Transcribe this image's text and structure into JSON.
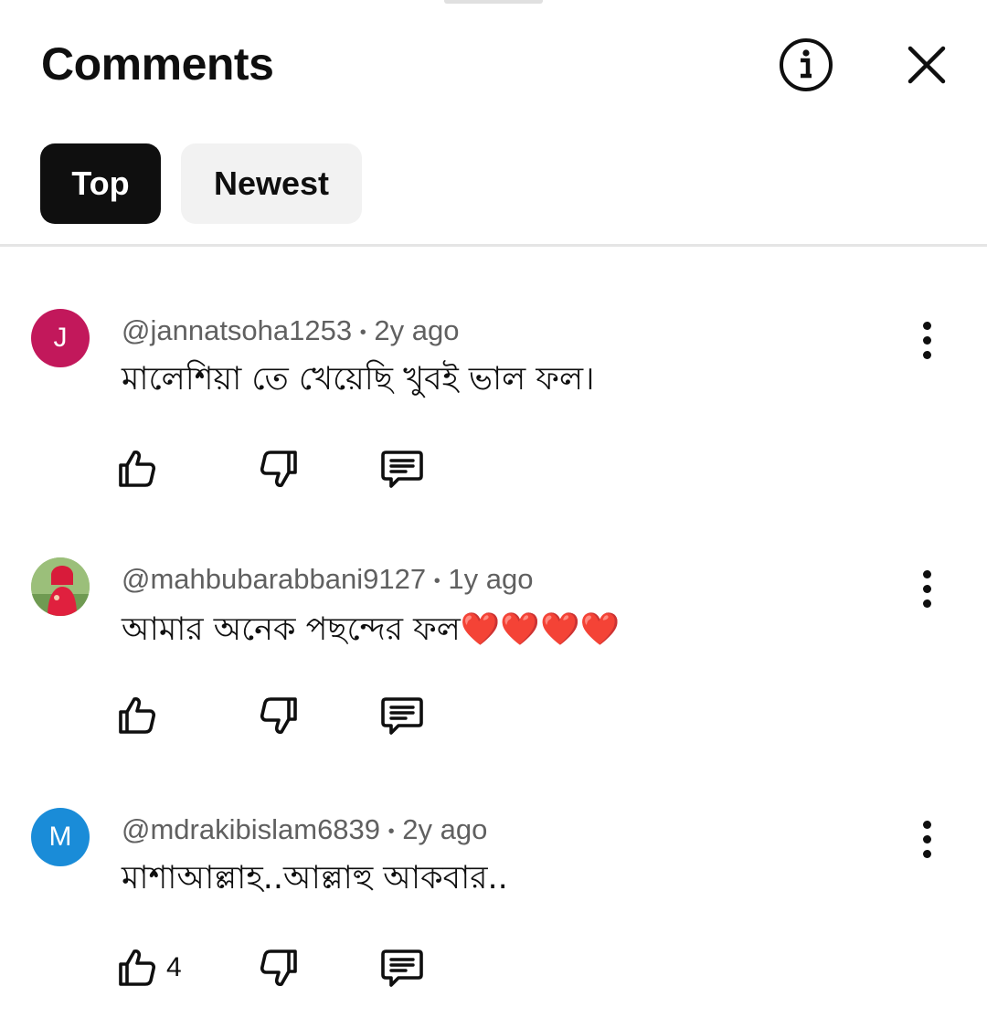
{
  "header": {
    "title": "Comments",
    "info_icon": "info-icon",
    "close_icon": "close-icon"
  },
  "tabs": [
    {
      "label": "Top",
      "selected": true
    },
    {
      "label": "Newest",
      "selected": false
    }
  ],
  "comments": [
    {
      "avatar_letter": "J",
      "avatar_color": "#c2185b",
      "author": "@jannatsoha1253",
      "separator": "•",
      "time": "2y ago",
      "text": "মালেশিয়া তে খেয়েছি খুবই ভাল ফল।",
      "likes": ""
    },
    {
      "avatar_letter": "",
      "avatar_color": "#a8c48a",
      "avatar_photo": true,
      "author": "@mahbubarabbani9127",
      "separator": "•",
      "time": "1y ago",
      "text": "আমার অনেক পছন্দের ফল",
      "emoji": "❤️❤️❤️❤️",
      "likes": ""
    },
    {
      "avatar_letter": "M",
      "avatar_color": "#1a8cd8",
      "author": "@mdrakibislam6839",
      "separator": "•",
      "time": "2y ago",
      "text": "মাশাআল্লাহ..আল্লাহু আকবার..",
      "likes": "4"
    }
  ],
  "colors": {
    "chip_selected_bg": "#0f0f0f",
    "chip_bg": "#f2f2f2",
    "meta_text": "#606060",
    "heart": "#e0202e"
  }
}
